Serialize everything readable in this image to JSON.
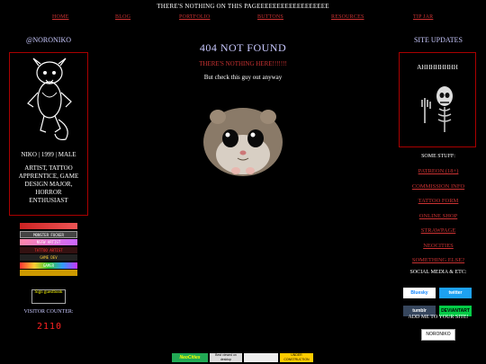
{
  "top_banner": "THERE'S NOTHING ON THIS PAGEEEEEEEEEEEEEEEEEE",
  "nav": [
    "HOME",
    "BLOG",
    "PORTFOLIO",
    "BUTTONS",
    "RESOURCES",
    "TIP JAR"
  ],
  "left": {
    "username": "@NORONIKO",
    "profile_lines": [
      "NIKO | 1999 | MALE",
      "ARTIST, TATTOO",
      "APPRENTICE, GAME",
      "DESIGN MAJOR,",
      "HORROR",
      "ENTHUSIAST"
    ],
    "badges": [
      "",
      "MONSTER FUCKER",
      "NSFW ARTIST",
      "TATTOO ARTIST",
      "GAME DEV",
      "GAMER",
      ""
    ],
    "guestbook": "Sign guestbook",
    "visitor_label": "VISITOR COUNTER:",
    "visitor_count": "2110"
  },
  "center": {
    "title": "404 NOT FOUND",
    "subtitle": "THERE'S NOTHING HERE!!!!!!!",
    "caption": "But check this guy out anyway"
  },
  "right": {
    "title": "SITE UPDATES",
    "updates_text": "AHHHHHHHH",
    "some_stuff": "SOME STUFF:",
    "links": [
      "PATREON (18+)",
      "COMMISSION INFO",
      "TATTOO FORM",
      "ONLINE SHOP",
      "STRAWPAGE",
      "NEOCITIES",
      "SOMETHING ELSE?"
    ],
    "social_label": "SOCIAL MEDIA & ETC:",
    "social_buttons": [
      "Bluesky",
      "twitter",
      "tumblr",
      "DEVIANTART"
    ],
    "addme_label": "ADD ME TO YOUR SITE!",
    "add_badge": "NORONIKO"
  },
  "footer_buttons": [
    "NeoCities",
    "Best viewed on desktop",
    "",
    "UNDER CONSTRUCTION"
  ],
  "colors": {
    "link": "#cc3333",
    "accent": "#c9c9ff",
    "border": "#aa0000"
  }
}
